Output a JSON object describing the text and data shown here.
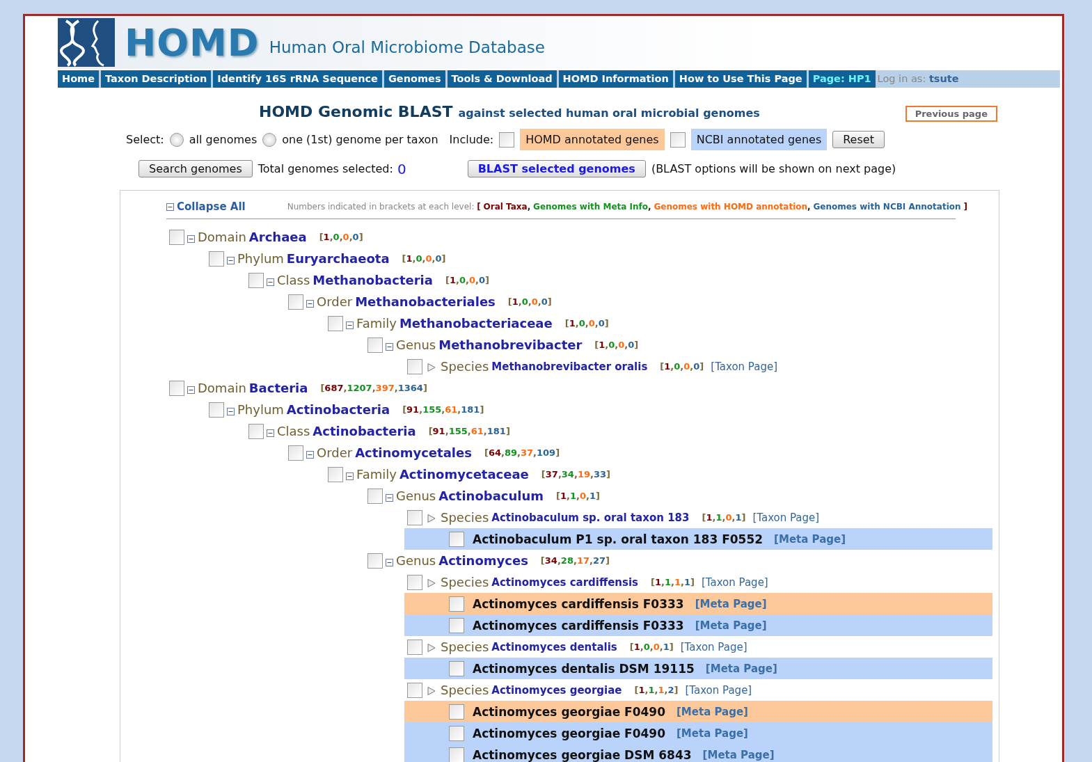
{
  "header": {
    "logo_title": "HOMD",
    "subtitle": "Human Oral Microbiome Database"
  },
  "nav": [
    {
      "label": "Home",
      "selected": false
    },
    {
      "label": "Taxon Description",
      "selected": false
    },
    {
      "label": "Identify 16S rRNA Sequence",
      "selected": false
    },
    {
      "label": "Genomes",
      "selected": false
    },
    {
      "label": "Tools & Download",
      "selected": false
    },
    {
      "label": "HOMD Information",
      "selected": false
    },
    {
      "label": "How to Use This Page",
      "selected": false
    },
    {
      "label": "Page: HP1",
      "selected": true
    }
  ],
  "login": {
    "label": "Log in as:",
    "user": "tsute"
  },
  "title": {
    "main": "HOMD Genomic BLAST",
    "sub": "against selected human oral microbial genomes"
  },
  "previous_button": "Previous page",
  "select": {
    "label": "Select:",
    "options": [
      {
        "label": "all genomes",
        "selected": false
      },
      {
        "label": "one (1st) genome per taxon",
        "selected": false
      }
    ]
  },
  "include": {
    "label": "Include:",
    "options": [
      {
        "label": "HOMD annotated genes",
        "checked": false,
        "color": "#fdc89a"
      },
      {
        "label": "NCBI annotated genes",
        "checked": false,
        "color": "#b9d3fa"
      }
    ]
  },
  "reset_button": "Reset",
  "search_button": "Search genomes",
  "total_label": "Total genomes selected:",
  "total_value": "0",
  "blast_button": "BLAST selected genomes",
  "blast_note": "(BLAST options will be shown on next page)",
  "tree": {
    "collapse_label": "Collapse All",
    "legend": {
      "intro": "Numbers indicated in brackets at each level:",
      "open": "[",
      "close": "]",
      "items": [
        {
          "label": "Oral Taxa",
          "sep": ",",
          "color": "#7a0000"
        },
        {
          "label": "Genomes with Meta Info",
          "sep": ",",
          "color": "#12921e"
        },
        {
          "label": "Genomes with HOMD annotation",
          "sep": ",",
          "color": "#ff6a10"
        },
        {
          "label": "Genomes with NCBI Annotation",
          "color": "#2a6496"
        }
      ]
    },
    "nodes": [
      {
        "kind": "rank",
        "rank": "Domain",
        "name": "Archaea",
        "counts": "[1,0,0,0]",
        "checked": false,
        "expanded": true,
        "children": [
          {
            "kind": "rank",
            "rank": "Phylum",
            "name": "Euryarchaeota",
            "counts": "[1,0,0,0]",
            "checked": false,
            "expanded": true,
            "children": [
              {
                "kind": "rank",
                "rank": "Class",
                "name": "Methanobacteria",
                "counts": "[1,0,0,0]",
                "checked": false,
                "expanded": true,
                "children": [
                  {
                    "kind": "rank",
                    "rank": "Order",
                    "name": "Methanobacteriales",
                    "counts": "[1,0,0,0]",
                    "checked": false,
                    "expanded": true,
                    "children": [
                      {
                        "kind": "rank",
                        "rank": "Family",
                        "name": "Methanobacteriaceae",
                        "counts": "[1,0,0,0]",
                        "checked": false,
                        "expanded": true,
                        "children": [
                          {
                            "kind": "rank",
                            "rank": "Genus",
                            "name": "Methanobrevibacter",
                            "counts": "[1,0,0,0]",
                            "checked": false,
                            "expanded": true,
                            "children": [
                              {
                                "kind": "species",
                                "rank": "Species",
                                "name": "Methanobrevibacter oralis",
                                "counts": "[1,0,0,0]",
                                "checked": false,
                                "link": "[Taxon Page]"
                              }
                            ]
                          }
                        ]
                      }
                    ]
                  }
                ]
              }
            ]
          }
        ]
      },
      {
        "kind": "rank",
        "rank": "Domain",
        "name": "Bacteria",
        "counts": "[687,1207,397,1364]",
        "checked": false,
        "expanded": true,
        "children": [
          {
            "kind": "rank",
            "rank": "Phylum",
            "name": "Actinobacteria",
            "counts": "[91,155,61,181]",
            "checked": false,
            "expanded": true,
            "children": [
              {
                "kind": "rank",
                "rank": "Class",
                "name": "Actinobacteria",
                "counts": "[91,155,61,181]",
                "checked": false,
                "expanded": true,
                "children": [
                  {
                    "kind": "rank",
                    "rank": "Order",
                    "name": "Actinomycetales",
                    "counts": "[64,89,37,109]",
                    "checked": false,
                    "expanded": true,
                    "children": [
                      {
                        "kind": "rank",
                        "rank": "Family",
                        "name": "Actinomycetaceae",
                        "counts": "[37,34,19,33]",
                        "checked": false,
                        "expanded": true,
                        "children": [
                          {
                            "kind": "rank",
                            "rank": "Genus",
                            "name": "Actinobaculum",
                            "counts": "[1,1,0,1]",
                            "checked": false,
                            "expanded": true,
                            "children": [
                              {
                                "kind": "species",
                                "rank": "Species",
                                "name": "Actinobaculum sp. oral taxon 183",
                                "counts": "[1,1,0,1]",
                                "checked": false,
                                "link": "[Taxon Page]",
                                "children": [
                                  {
                                    "kind": "genome",
                                    "color": "#b9d3fa",
                                    "name": "Actinobaculum P1 sp. oral taxon 183 F0552",
                                    "checked": false,
                                    "link": "[Meta Page]"
                                  }
                                ]
                              }
                            ]
                          },
                          {
                            "kind": "rank",
                            "rank": "Genus",
                            "name": "Actinomyces",
                            "counts": "[34,28,17,27]",
                            "checked": false,
                            "expanded": true,
                            "children": [
                              {
                                "kind": "species",
                                "rank": "Species",
                                "name": "Actinomyces cardiffensis",
                                "counts": "[1,1,1,1]",
                                "checked": false,
                                "link": "[Taxon Page]",
                                "children": [
                                  {
                                    "kind": "genome",
                                    "color": "#fdc89a",
                                    "name": "Actinomyces cardiffensis F0333",
                                    "checked": false,
                                    "link": "[Meta Page]"
                                  },
                                  {
                                    "kind": "genome",
                                    "color": "#b9d3fa",
                                    "name": "Actinomyces cardiffensis F0333",
                                    "checked": false,
                                    "link": "[Meta Page]"
                                  }
                                ]
                              },
                              {
                                "kind": "species",
                                "rank": "Species",
                                "name": "Actinomyces dentalis",
                                "counts": "[1,0,0,1]",
                                "checked": false,
                                "link": "[Taxon Page]",
                                "children": [
                                  {
                                    "kind": "genome",
                                    "color": "#b9d3fa",
                                    "name": "Actinomyces dentalis DSM 19115",
                                    "checked": false,
                                    "link": "[Meta Page]"
                                  }
                                ]
                              },
                              {
                                "kind": "species",
                                "rank": "Species",
                                "name": "Actinomyces georgiae",
                                "counts": "[1,1,1,2]",
                                "checked": false,
                                "link": "[Taxon Page]",
                                "children": [
                                  {
                                    "kind": "genome",
                                    "color": "#fdc89a",
                                    "name": "Actinomyces georgiae F0490",
                                    "checked": false,
                                    "link": "[Meta Page]"
                                  },
                                  {
                                    "kind": "genome",
                                    "color": "#b9d3fa",
                                    "name": "Actinomyces georgiae F0490",
                                    "checked": false,
                                    "link": "[Meta Page]"
                                  },
                                  {
                                    "kind": "genome",
                                    "color": "#b9d3fa",
                                    "name": "Actinomyces georgiae DSM 6843",
                                    "checked": false,
                                    "link": "[Meta Page]"
                                  }
                                ]
                              }
                            ]
                          }
                        ]
                      }
                    ]
                  }
                ]
              }
            ]
          }
        ]
      }
    ]
  }
}
